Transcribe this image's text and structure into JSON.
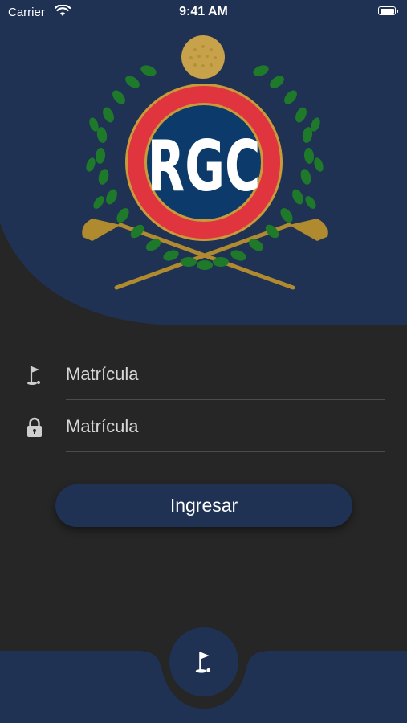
{
  "status_bar": {
    "carrier": "Carrier",
    "time": "9:41 AM",
    "battery_level": 1.0
  },
  "logo": {
    "text": "RGC",
    "colors": {
      "ring": "#e0353f",
      "center": "#0c3a6b",
      "laurel": "#1e7a2a",
      "ball": "#c8a24a",
      "clubs": "#b08a2e"
    }
  },
  "form": {
    "member_field": {
      "placeholder": "Matrícula",
      "icon": "golf-flag-icon"
    },
    "password_field": {
      "placeholder": "Matrícula",
      "icon": "lock-icon"
    },
    "submit_label": "Ingresar"
  },
  "bottom_nav": {
    "center_icon": "golf-flag-icon"
  },
  "theme": {
    "background": "#262626",
    "header": "#1f3253",
    "text": "#d6d6d6",
    "button_text": "#ffffff"
  }
}
